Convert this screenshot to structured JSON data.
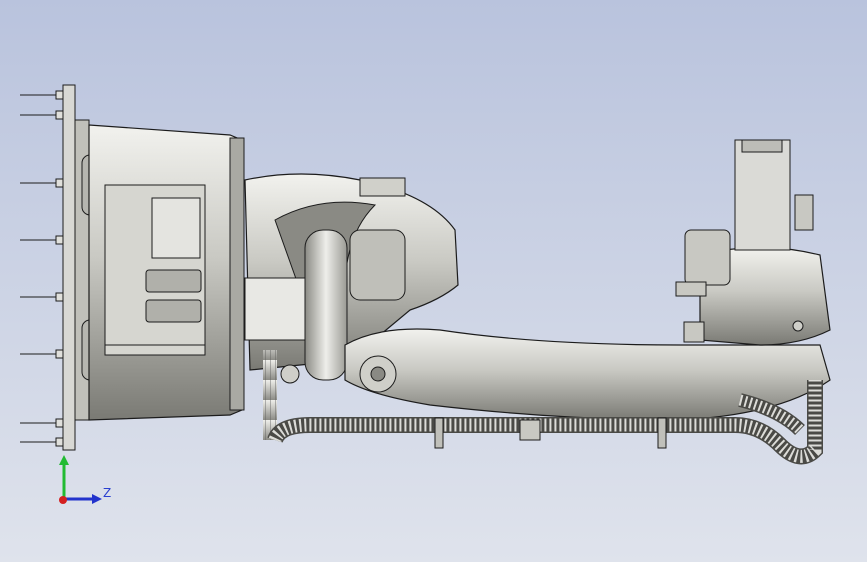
{
  "viewport": {
    "background_top": "#b9c3dd",
    "background_bottom": "#dfe3ec",
    "model_name": "robot-arm-assembly"
  },
  "triad": {
    "axes": [
      {
        "name": "y-axis",
        "color": "#22bb33"
      },
      {
        "name": "z-axis",
        "color": "#2233cc",
        "label": "Z"
      },
      {
        "name": "x-axis",
        "color": "#d42020"
      }
    ]
  },
  "colors": {
    "metal_light": "#e6e6e2",
    "metal_mid": "#b8b8b2",
    "metal_dark": "#6e6e68",
    "edge": "#1c1c1c"
  }
}
